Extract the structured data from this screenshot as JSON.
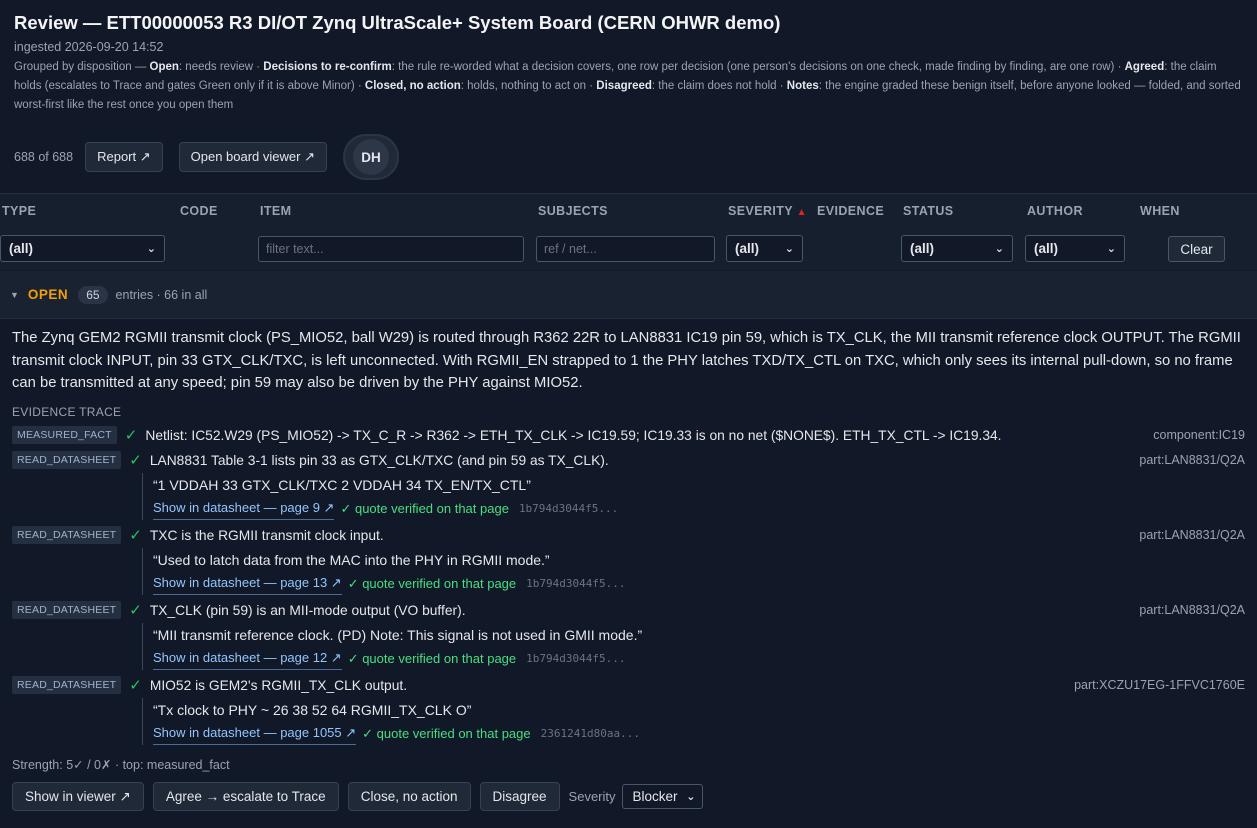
{
  "header": {
    "title": "Review — ETT00000053 R3 DI/OT Zynq UltraScale+ System Board (CERN OHWR demo)",
    "ingested": "ingested 2026-09-20 14:52",
    "legend": [
      {
        "t": "Grouped by disposition — "
      },
      {
        "b": "Open"
      },
      {
        "t": ": needs review · "
      },
      {
        "b": "Decisions to re-confirm"
      },
      {
        "t": ": the rule re-worded what a decision covers, one row per decision (one person's decisions on one check, made finding by finding, are one row) · "
      },
      {
        "b": "Agreed"
      },
      {
        "t": ": the claim holds (escalates to Trace and gates Green only if it is above Minor) · "
      },
      {
        "b": "Closed, no action"
      },
      {
        "t": ": holds, nothing to act on · "
      },
      {
        "b": "Disagreed"
      },
      {
        "t": ": the claim does not hold · "
      },
      {
        "b": "Notes"
      },
      {
        "t": ": the engine graded these benign itself, before anyone looked — folded, and sorted worst-first like the rest once you open them"
      }
    ]
  },
  "toolbar": {
    "count": "688 of 688",
    "report_label": "Report ↗",
    "board_viewer_label": "Open board viewer ↗",
    "avatar_initials": "DH"
  },
  "table": {
    "headers": {
      "type": "TYPE",
      "code": "CODE",
      "item": "ITEM",
      "subjects": "SUBJECTS",
      "severity": "SEVERITY",
      "severity_sort": "▲",
      "evidence": "EVIDENCE",
      "status": "STATUS",
      "author": "AUTHOR",
      "when": "WHEN"
    },
    "filters": {
      "type_value": "(all)",
      "item_placeholder": "filter text...",
      "subjects_placeholder": "ref / net...",
      "severity_value": "(all)",
      "status_value": "(all)",
      "author_value": "(all)",
      "clear_label": "Clear"
    }
  },
  "group": {
    "label": "OPEN",
    "count": "65",
    "entries": "entries · 66 in all"
  },
  "finding": {
    "claim": "The Zynq GEM2 RGMII transmit clock (PS_MIO52, ball W29) is routed through R362 22R to LAN8831 IC19 pin 59, which is TX_CLK, the MII transmit reference clock OUTPUT. The RGMII transmit clock INPUT, pin 33 GTX_CLK/TXC, is left unconnected. With RGMII_EN strapped to 1 the PHY latches TXD/TX_CTL on TXC, which only sees its internal pull-down, so no frame can be transmitted at any speed; pin 59 may also be driven by the PHY against MIO52.",
    "evidence_title": "EVIDENCE TRACE",
    "evidence": [
      {
        "tag": "MEASURED_FACT",
        "text": "Netlist: IC52.W29 (PS_MIO52) -> TX_C_R -> R362 -> ETH_TX_CLK -> IC19.59; IC19.33 is on no net ($NONE$). ETH_TX_CTL -> IC19.34.",
        "subject": "component:IC19"
      },
      {
        "tag": "READ_DATASHEET",
        "text": "LAN8831 Table 3-1 lists pin 33 as GTX_CLK/TXC (and pin 59 as TX_CLK).",
        "subject": "part:LAN8831/Q2A",
        "quote": "“1 VDDAH 33 GTX_CLK/TXC 2 VDDAH 34 TX_EN/TX_CTL”",
        "link": "Show in datasheet — page 9 ↗",
        "verified": "✓ quote verified on that page",
        "hash": "1b794d3044f5..."
      },
      {
        "tag": "READ_DATASHEET",
        "text": "TXC is the RGMII transmit clock input.",
        "subject": "part:LAN8831/Q2A",
        "quote": "“Used to latch data from the MAC into the PHY in RGMII mode.”",
        "link": "Show in datasheet — page 13 ↗",
        "verified": "✓ quote verified on that page",
        "hash": "1b794d3044f5..."
      },
      {
        "tag": "READ_DATASHEET",
        "text": "TX_CLK (pin 59) is an MII-mode output (VO buffer).",
        "subject": "part:LAN8831/Q2A",
        "quote": "“MII transmit reference clock. (PD) Note: This signal is not used in GMII mode.”",
        "link": "Show in datasheet — page 12 ↗",
        "verified": "✓ quote verified on that page",
        "hash": "1b794d3044f5..."
      },
      {
        "tag": "READ_DATASHEET",
        "text": "MIO52 is GEM2's RGMII_TX_CLK output.",
        "subject": "part:XCZU17EG-1FFVC1760E",
        "quote": "“Tx clock to PHY ~ 26 38 52 64 RGMII_TX_CLK O”",
        "link": "Show in datasheet — page 1055 ↗",
        "verified": "✓ quote verified on that page",
        "hash": "2361241d80aa..."
      }
    ],
    "strength": "Strength: 5✓ / 0✗ · top: measured_fact",
    "actions": {
      "show_in_viewer": "Show in viewer ↗",
      "agree": "Agree → escalate to Trace",
      "close": "Close, no action",
      "disagree": "Disagree",
      "severity_label": "Severity",
      "severity_value": "Blocker"
    }
  }
}
